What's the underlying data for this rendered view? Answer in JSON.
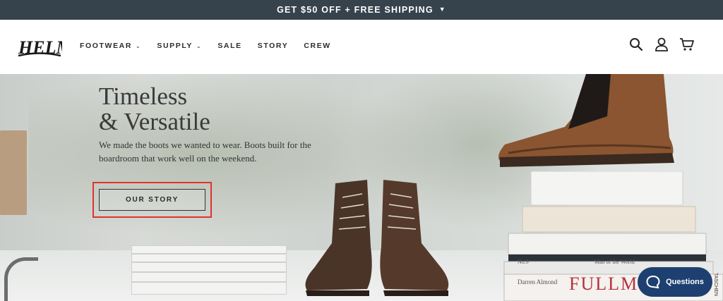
{
  "announcement": {
    "text": "GET $50 OFF + FREE SHIPPING",
    "icon": "chevron-down-icon"
  },
  "header": {
    "logo_text": "HELM",
    "nav": [
      {
        "label": "FOOTWEAR",
        "has_dropdown": true
      },
      {
        "label": "SUPPLY",
        "has_dropdown": true
      },
      {
        "label": "SALE",
        "has_dropdown": false
      },
      {
        "label": "STORY",
        "has_dropdown": false
      },
      {
        "label": "CREW",
        "has_dropdown": false
      }
    ],
    "icons": [
      "search-icon",
      "account-icon",
      "cart-icon"
    ]
  },
  "hero": {
    "title": "Timeless\n& Versatile",
    "body": "We made the boots we wanted to wear. Boots built for the boardroom that work well on the weekend.",
    "cta_label": "OUR STORY",
    "book_spines": [
      "No.9",
      "Man of the World",
      "Darren Almond",
      "FULLMO",
      "TASCHEN"
    ]
  },
  "chat": {
    "label": "Questions",
    "icon": "chat-bubble-icon"
  },
  "colors": {
    "announcement_bg": "#36434d",
    "highlight": "#e0332f",
    "chat_bg": "#1d4070",
    "book_title_red": "#b5323a"
  }
}
